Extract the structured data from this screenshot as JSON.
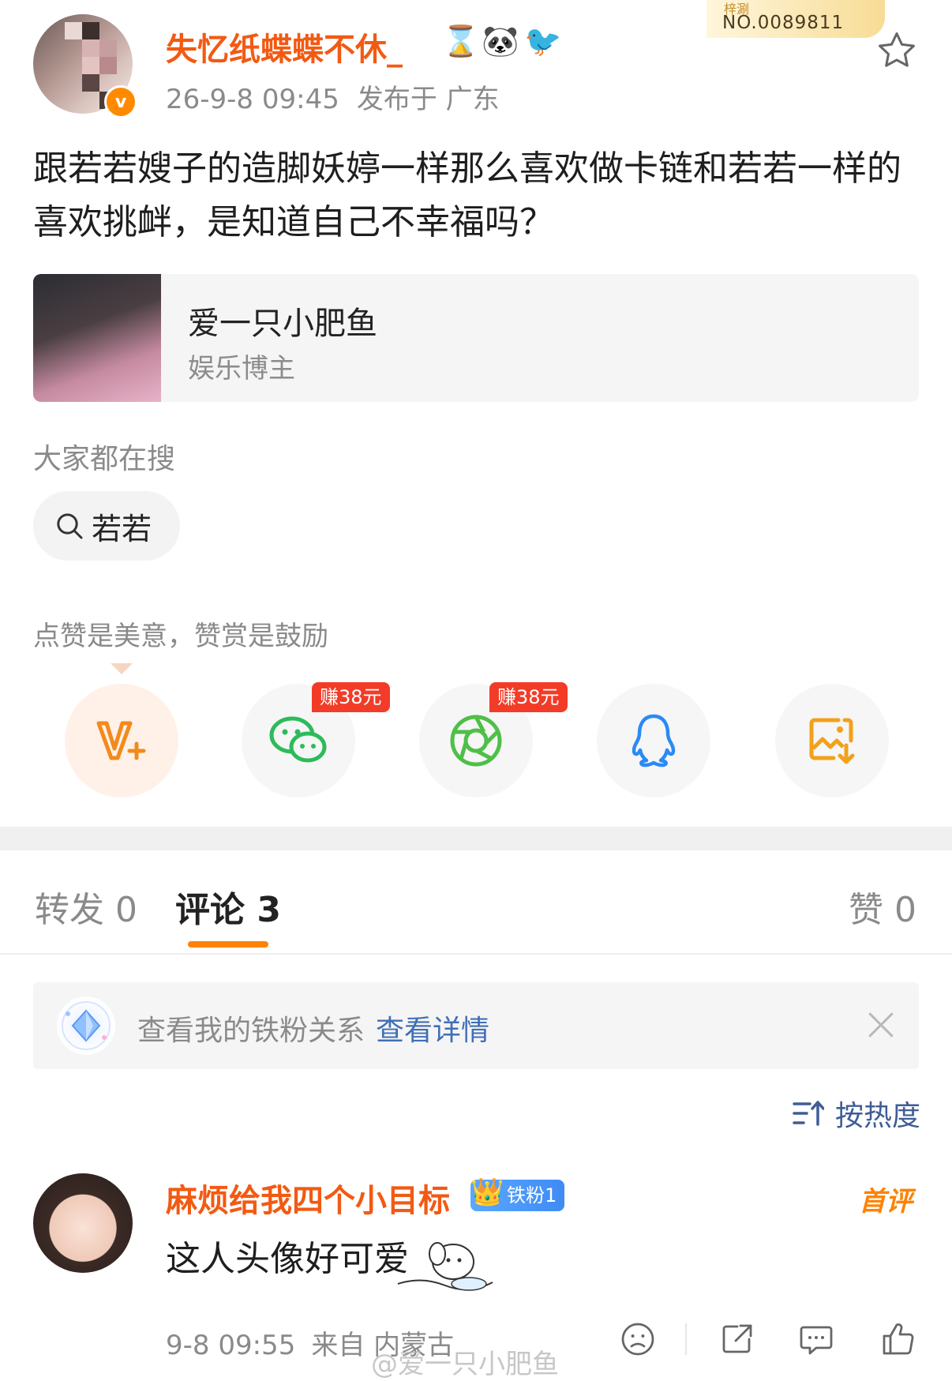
{
  "post": {
    "author": "失忆纸蝶蝶不休_",
    "time": "26-9-8 09:45",
    "location": "发布于 广东",
    "serial_top": "梓涮",
    "serial_no": "NO.0089811",
    "text": "跟若若嫂子的造脚妖婷一样那么喜欢做卡链和若若一样的喜欢挑衅，是知道自己不幸福吗？"
  },
  "card": {
    "name": "爱一只小肥鱼",
    "subtitle": "娱乐博主"
  },
  "search": {
    "section_label": "大家都在搜",
    "chip": "若若"
  },
  "reward": {
    "label": "点赞是美意，赞赏是鼓励",
    "earn_wechat": "赚38元",
    "earn_moments": "赚38元"
  },
  "tabs": {
    "repost": "转发 0",
    "comments": "评论 3",
    "likes": "赞 0"
  },
  "fan_bar": {
    "text": "查看我的铁粉关系",
    "link": "查看详情"
  },
  "sort": {
    "label": "按热度"
  },
  "comment": {
    "author": "麻烦给我四个小目标",
    "badge": "铁粉1",
    "first_tag": "首评",
    "text": "这人头像好可爱",
    "time": "9-8 09:55",
    "location": "来自 内蒙古"
  },
  "watermark": "@爱一只小肥鱼",
  "colors": {
    "accent_orange": "#ff8200",
    "username": "#f25a13",
    "link_blue": "#3f6fb6"
  }
}
